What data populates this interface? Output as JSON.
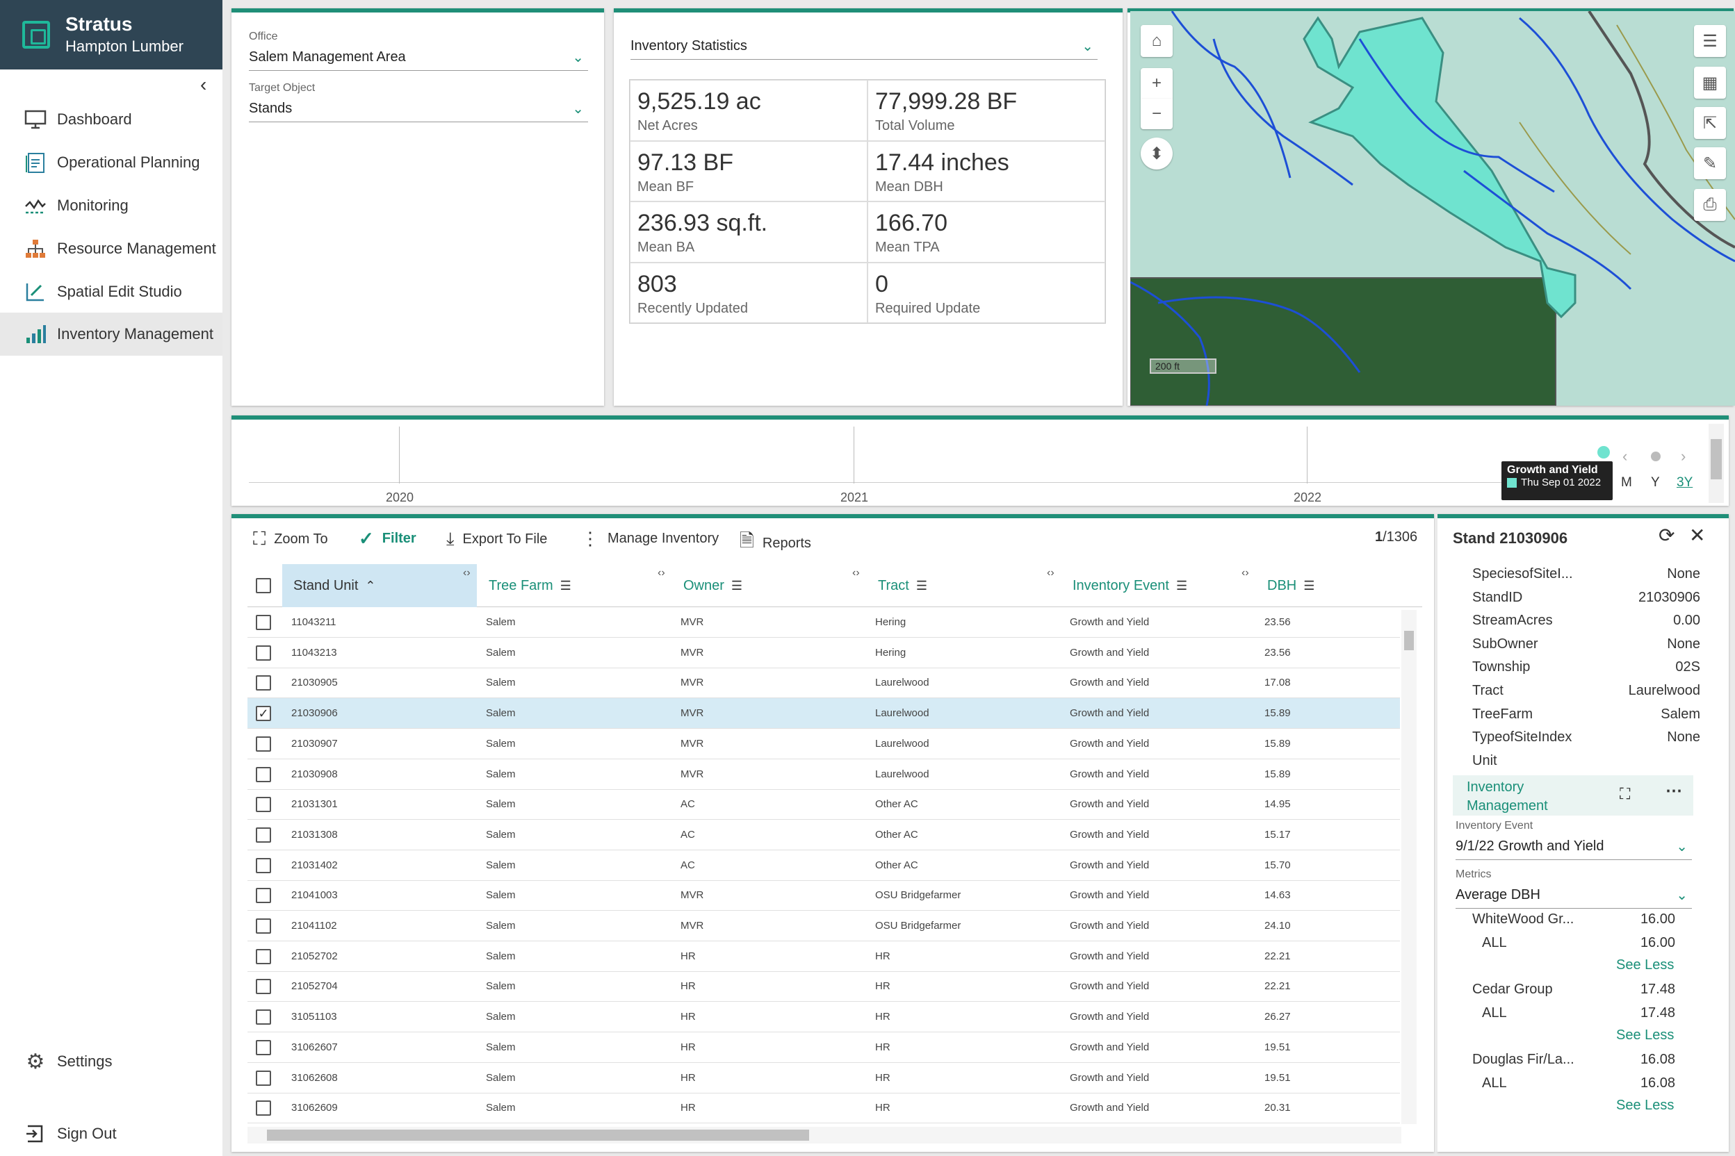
{
  "brand": {
    "title": "Stratus",
    "subtitle": "Hampton Lumber"
  },
  "sidebar": {
    "collapse_icon": "‹",
    "items": [
      {
        "label": "Dashboard",
        "icon": "monitor-icon"
      },
      {
        "label": "Operational Planning",
        "icon": "clipboard-icon"
      },
      {
        "label": "Monitoring",
        "icon": "activity-icon"
      },
      {
        "label": "Resource Management",
        "icon": "org-chart-icon"
      },
      {
        "label": "Spatial Edit Studio",
        "icon": "edit-chart-icon"
      },
      {
        "label": "Inventory Management",
        "icon": "bar-chart-icon",
        "active": true
      }
    ],
    "settings": "Settings",
    "sign_out": "Sign Out"
  },
  "selector": {
    "office_label": "Office",
    "office_value": "Salem Management Area",
    "target_label": "Target Object",
    "target_value": "Stands"
  },
  "stats": {
    "dropdown": "Inventory Statistics",
    "cells": [
      {
        "value": "9,525.19 ac",
        "label": "Net Acres"
      },
      {
        "value": "77,999.28 BF",
        "label": "Total Volume"
      },
      {
        "value": "97.13 BF",
        "label": "Mean BF"
      },
      {
        "value": "17.44 inches",
        "label": "Mean DBH"
      },
      {
        "value": "236.93 sq.ft.",
        "label": "Mean BA"
      },
      {
        "value": "166.70",
        "label": "Mean TPA"
      },
      {
        "value": "803",
        "label": "Recently Updated"
      },
      {
        "value": "0",
        "label": "Required Update"
      }
    ]
  },
  "map": {
    "scale": "200 ft"
  },
  "timeline": {
    "years": [
      "2020",
      "2021",
      "2022"
    ],
    "tooltip_title": "Growth and Yield",
    "tooltip_date": "Thu Sep 01 2022",
    "zoom_options": [
      "M",
      "Y",
      "3Y"
    ],
    "event_color": "#6fe3cf"
  },
  "toolbar": {
    "zoom_to": "Zoom To",
    "filter": "Filter",
    "export": "Export To File",
    "manage": "Manage Inventory",
    "reports": "Reports",
    "page_current": "1",
    "page_total": "/1306"
  },
  "table": {
    "headers": [
      "Stand Unit",
      "Tree Farm",
      "Owner",
      "Tract",
      "Inventory Event",
      "DBH"
    ],
    "rows": [
      {
        "unit": "11043211",
        "farm": "Salem",
        "owner": "MVR",
        "tract": "Hering",
        "event": "Growth and Yield",
        "dbh": "23.56",
        "checked": false
      },
      {
        "unit": "11043213",
        "farm": "Salem",
        "owner": "MVR",
        "tract": "Hering",
        "event": "Growth and Yield",
        "dbh": "23.56",
        "checked": false
      },
      {
        "unit": "21030905",
        "farm": "Salem",
        "owner": "MVR",
        "tract": "Laurelwood",
        "event": "Growth and Yield",
        "dbh": "17.08",
        "checked": false
      },
      {
        "unit": "21030906",
        "farm": "Salem",
        "owner": "MVR",
        "tract": "Laurelwood",
        "event": "Growth and Yield",
        "dbh": "15.89",
        "checked": true
      },
      {
        "unit": "21030907",
        "farm": "Salem",
        "owner": "MVR",
        "tract": "Laurelwood",
        "event": "Growth and Yield",
        "dbh": "15.89",
        "checked": false
      },
      {
        "unit": "21030908",
        "farm": "Salem",
        "owner": "MVR",
        "tract": "Laurelwood",
        "event": "Growth and Yield",
        "dbh": "15.89",
        "checked": false
      },
      {
        "unit": "21031301",
        "farm": "Salem",
        "owner": "AC",
        "tract": "Other AC",
        "event": "Growth and Yield",
        "dbh": "14.95",
        "checked": false
      },
      {
        "unit": "21031308",
        "farm": "Salem",
        "owner": "AC",
        "tract": "Other AC",
        "event": "Growth and Yield",
        "dbh": "15.17",
        "checked": false
      },
      {
        "unit": "21031402",
        "farm": "Salem",
        "owner": "AC",
        "tract": "Other AC",
        "event": "Growth and Yield",
        "dbh": "15.70",
        "checked": false
      },
      {
        "unit": "21041003",
        "farm": "Salem",
        "owner": "MVR",
        "tract": "OSU Bridgefarmer",
        "event": "Growth and Yield",
        "dbh": "14.63",
        "checked": false
      },
      {
        "unit": "21041102",
        "farm": "Salem",
        "owner": "MVR",
        "tract": "OSU Bridgefarmer",
        "event": "Growth and Yield",
        "dbh": "24.10",
        "checked": false
      },
      {
        "unit": "21052702",
        "farm": "Salem",
        "owner": "HR",
        "tract": "HR",
        "event": "Growth and Yield",
        "dbh": "22.21",
        "checked": false
      },
      {
        "unit": "21052704",
        "farm": "Salem",
        "owner": "HR",
        "tract": "HR",
        "event": "Growth and Yield",
        "dbh": "22.21",
        "checked": false
      },
      {
        "unit": "31051103",
        "farm": "Salem",
        "owner": "HR",
        "tract": "HR",
        "event": "Growth and Yield",
        "dbh": "26.27",
        "checked": false
      },
      {
        "unit": "31062607",
        "farm": "Salem",
        "owner": "HR",
        "tract": "HR",
        "event": "Growth and Yield",
        "dbh": "19.51",
        "checked": false
      },
      {
        "unit": "31062608",
        "farm": "Salem",
        "owner": "HR",
        "tract": "HR",
        "event": "Growth and Yield",
        "dbh": "19.51",
        "checked": false
      },
      {
        "unit": "31062609",
        "farm": "Salem",
        "owner": "HR",
        "tract": "HR",
        "event": "Growth and Yield",
        "dbh": "20.31",
        "checked": false
      }
    ]
  },
  "detail": {
    "title": "Stand 21030906",
    "attributes": [
      {
        "key": "SpeciesofSiteI...",
        "value": "None"
      },
      {
        "key": "StandID",
        "value": "21030906"
      },
      {
        "key": "StreamAcres",
        "value": "0.00"
      },
      {
        "key": "SubOwner",
        "value": "None"
      },
      {
        "key": "Township",
        "value": "02S"
      },
      {
        "key": "Tract",
        "value": "Laurelwood"
      },
      {
        "key": "TreeFarm",
        "value": "Salem"
      },
      {
        "key": "TypeofSiteIndex",
        "value": "None"
      },
      {
        "key": "Unit",
        "value": ""
      }
    ],
    "section_title_1": "Inventory",
    "section_title_2": "Management",
    "event_label": "Inventory Event",
    "event_value": "9/1/22 Growth and Yield",
    "metrics_label": "Metrics",
    "metrics_value": "Average DBH",
    "groups": [
      {
        "name": "WhiteWood Gr...",
        "value": "16.00",
        "sub": "ALL",
        "sub_value": "16.00",
        "link": "See Less"
      },
      {
        "name": "Cedar Group",
        "value": "17.48",
        "sub": "ALL",
        "sub_value": "17.48",
        "link": "See Less"
      },
      {
        "name": "Douglas Fir/La...",
        "value": "16.08",
        "sub": "ALL",
        "sub_value": "16.08",
        "link": "See Less"
      }
    ]
  },
  "colors": {
    "accent": "#1f8f78",
    "brand_bg": "#2f4554",
    "selected_row": "#d6ebf5",
    "stand_fill": "#6fe3cf"
  }
}
